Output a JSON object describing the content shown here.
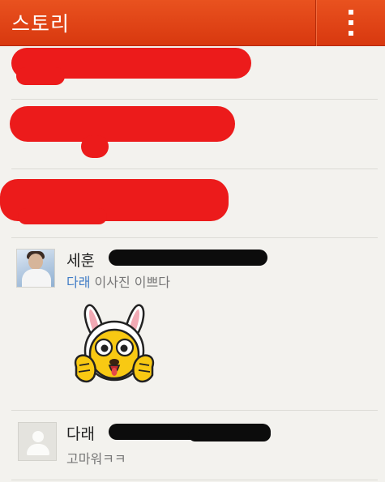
{
  "appbar": {
    "title": "스토리",
    "menu_icon": "more-vertical-icon",
    "color": "#e2461a"
  },
  "comments": [
    {
      "author": "세훈",
      "mention": "다래",
      "text": "이사진 이쁘다",
      "avatar": "profile-photo",
      "sticker": "bunny-ear-character-sticker"
    },
    {
      "author": "다래",
      "text": "고마워ㅋㅋ",
      "avatar": "default-avatar"
    }
  ],
  "colors": {
    "mention": "#3f7cc6",
    "redaction": "#ec1b1b"
  }
}
